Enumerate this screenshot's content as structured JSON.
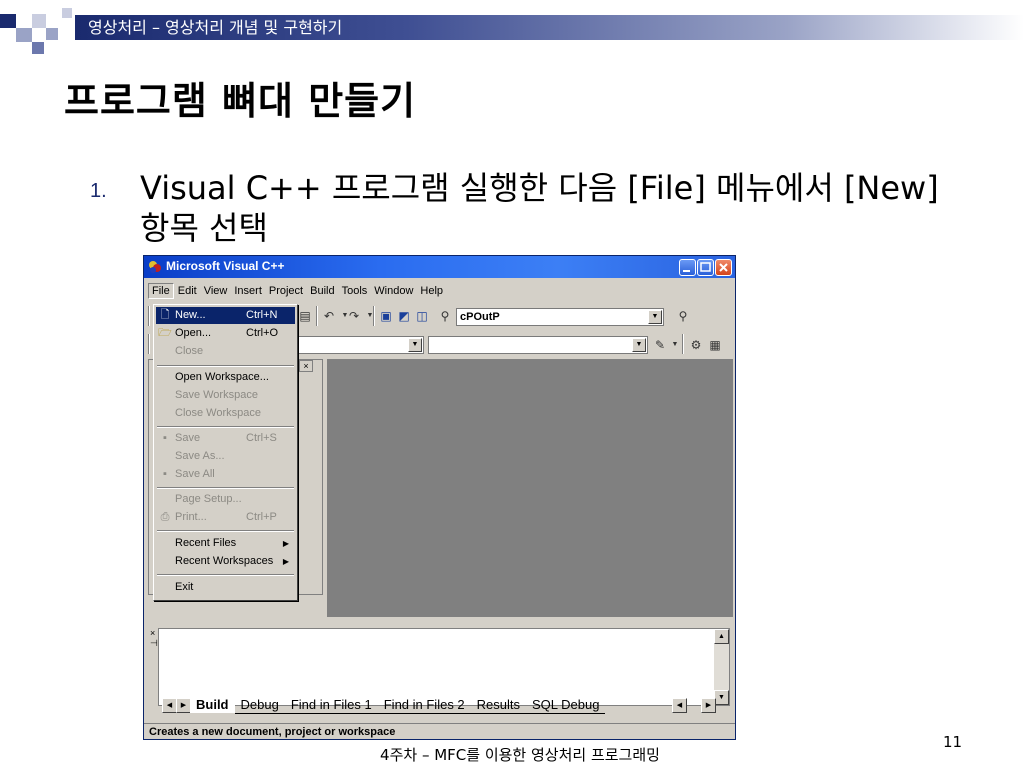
{
  "slide": {
    "header": "영상처리 – 영상처리 개념 및 구현하기",
    "title": "프로그램 뼈대 만들기",
    "bullet_number": "1.",
    "bullet_text": "Visual C++ 프로그램 실행한 다음 [File] 메뉴에서 [New] 항목 선택",
    "footer": "4주차 – MFC를 이용한 영상처리 프로그래밍",
    "page_number": "11"
  },
  "window": {
    "title": "Microsoft Visual C++",
    "menu": [
      "File",
      "Edit",
      "View",
      "Insert",
      "Project",
      "Build",
      "Tools",
      "Window",
      "Help"
    ],
    "toolbar_combo": "cPOutP",
    "file_menu": [
      {
        "label": "New...",
        "shortcut": "Ctrl+N",
        "icon": "new-file-icon",
        "highlighted": true,
        "disabled": false
      },
      {
        "label": "Open...",
        "shortcut": "Ctrl+O",
        "icon": "open-folder-icon",
        "highlighted": false,
        "disabled": false
      },
      {
        "label": "Close",
        "shortcut": "",
        "icon": "",
        "highlighted": false,
        "disabled": true
      },
      {
        "label": "Open Workspace...",
        "shortcut": "",
        "icon": "",
        "highlighted": false,
        "disabled": false
      },
      {
        "label": "Save Workspace",
        "shortcut": "",
        "icon": "",
        "highlighted": false,
        "disabled": true
      },
      {
        "label": "Close Workspace",
        "shortcut": "",
        "icon": "",
        "highlighted": false,
        "disabled": true
      },
      {
        "label": "Save",
        "shortcut": "Ctrl+S",
        "icon": "save-icon",
        "highlighted": false,
        "disabled": true
      },
      {
        "label": "Save As...",
        "shortcut": "",
        "icon": "",
        "highlighted": false,
        "disabled": true
      },
      {
        "label": "Save All",
        "shortcut": "",
        "icon": "save-all-icon",
        "highlighted": false,
        "disabled": true
      },
      {
        "label": "Page Setup...",
        "shortcut": "",
        "icon": "",
        "highlighted": false,
        "disabled": true
      },
      {
        "label": "Print...",
        "shortcut": "Ctrl+P",
        "icon": "print-icon",
        "highlighted": false,
        "disabled": true
      },
      {
        "label": "Recent Files",
        "shortcut": "",
        "icon": "",
        "highlighted": false,
        "disabled": false,
        "submenu": true
      },
      {
        "label": "Recent Workspaces",
        "shortcut": "",
        "icon": "",
        "highlighted": false,
        "disabled": false,
        "submenu": true
      },
      {
        "label": "Exit",
        "shortcut": "",
        "icon": "",
        "highlighted": false,
        "disabled": false
      }
    ],
    "output_tabs": [
      "Build",
      "Debug",
      "Find in Files 1",
      "Find in Files 2",
      "Results",
      "SQL Debug"
    ],
    "status_text": "Creates a new document, project or workspace"
  }
}
